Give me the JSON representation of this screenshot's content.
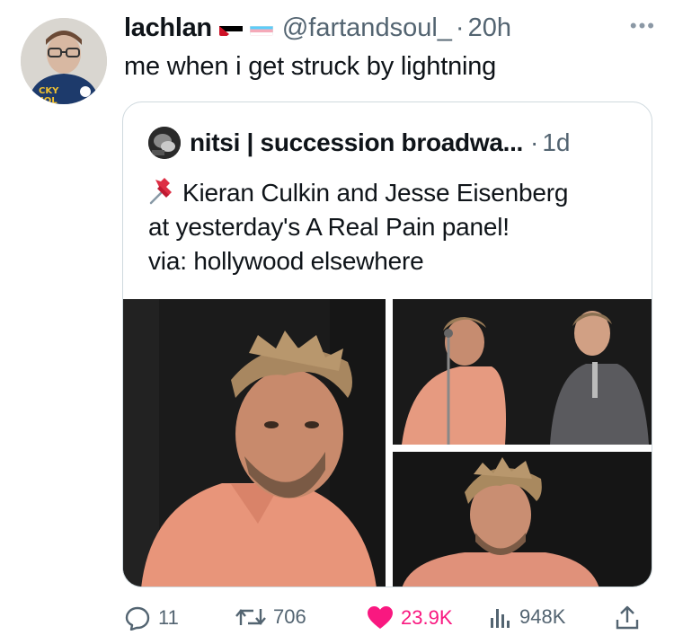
{
  "tweet": {
    "display_name": "lachlan",
    "handle": "@fartandsoul_",
    "separator": "·",
    "time": "20h",
    "text": "me when i get struck by lightning",
    "flags": [
      "palestine-flag",
      "transgender-flag"
    ]
  },
  "quoted": {
    "display_name": "nitsi | succession broadwa...",
    "separator": "·",
    "time": "1d",
    "lines": [
      "Kieran Culkin and Jesse Eisenberg",
      "at yesterday's A Real Pain panel!",
      "via: hollywood elsewhere"
    ],
    "icon": "pushpin-icon"
  },
  "actions": {
    "replies": "11",
    "retweets": "706",
    "likes": "23.9K",
    "views": "948K"
  },
  "colors": {
    "like": "#f91880",
    "muted": "#536471",
    "border": "#cfd9de"
  }
}
